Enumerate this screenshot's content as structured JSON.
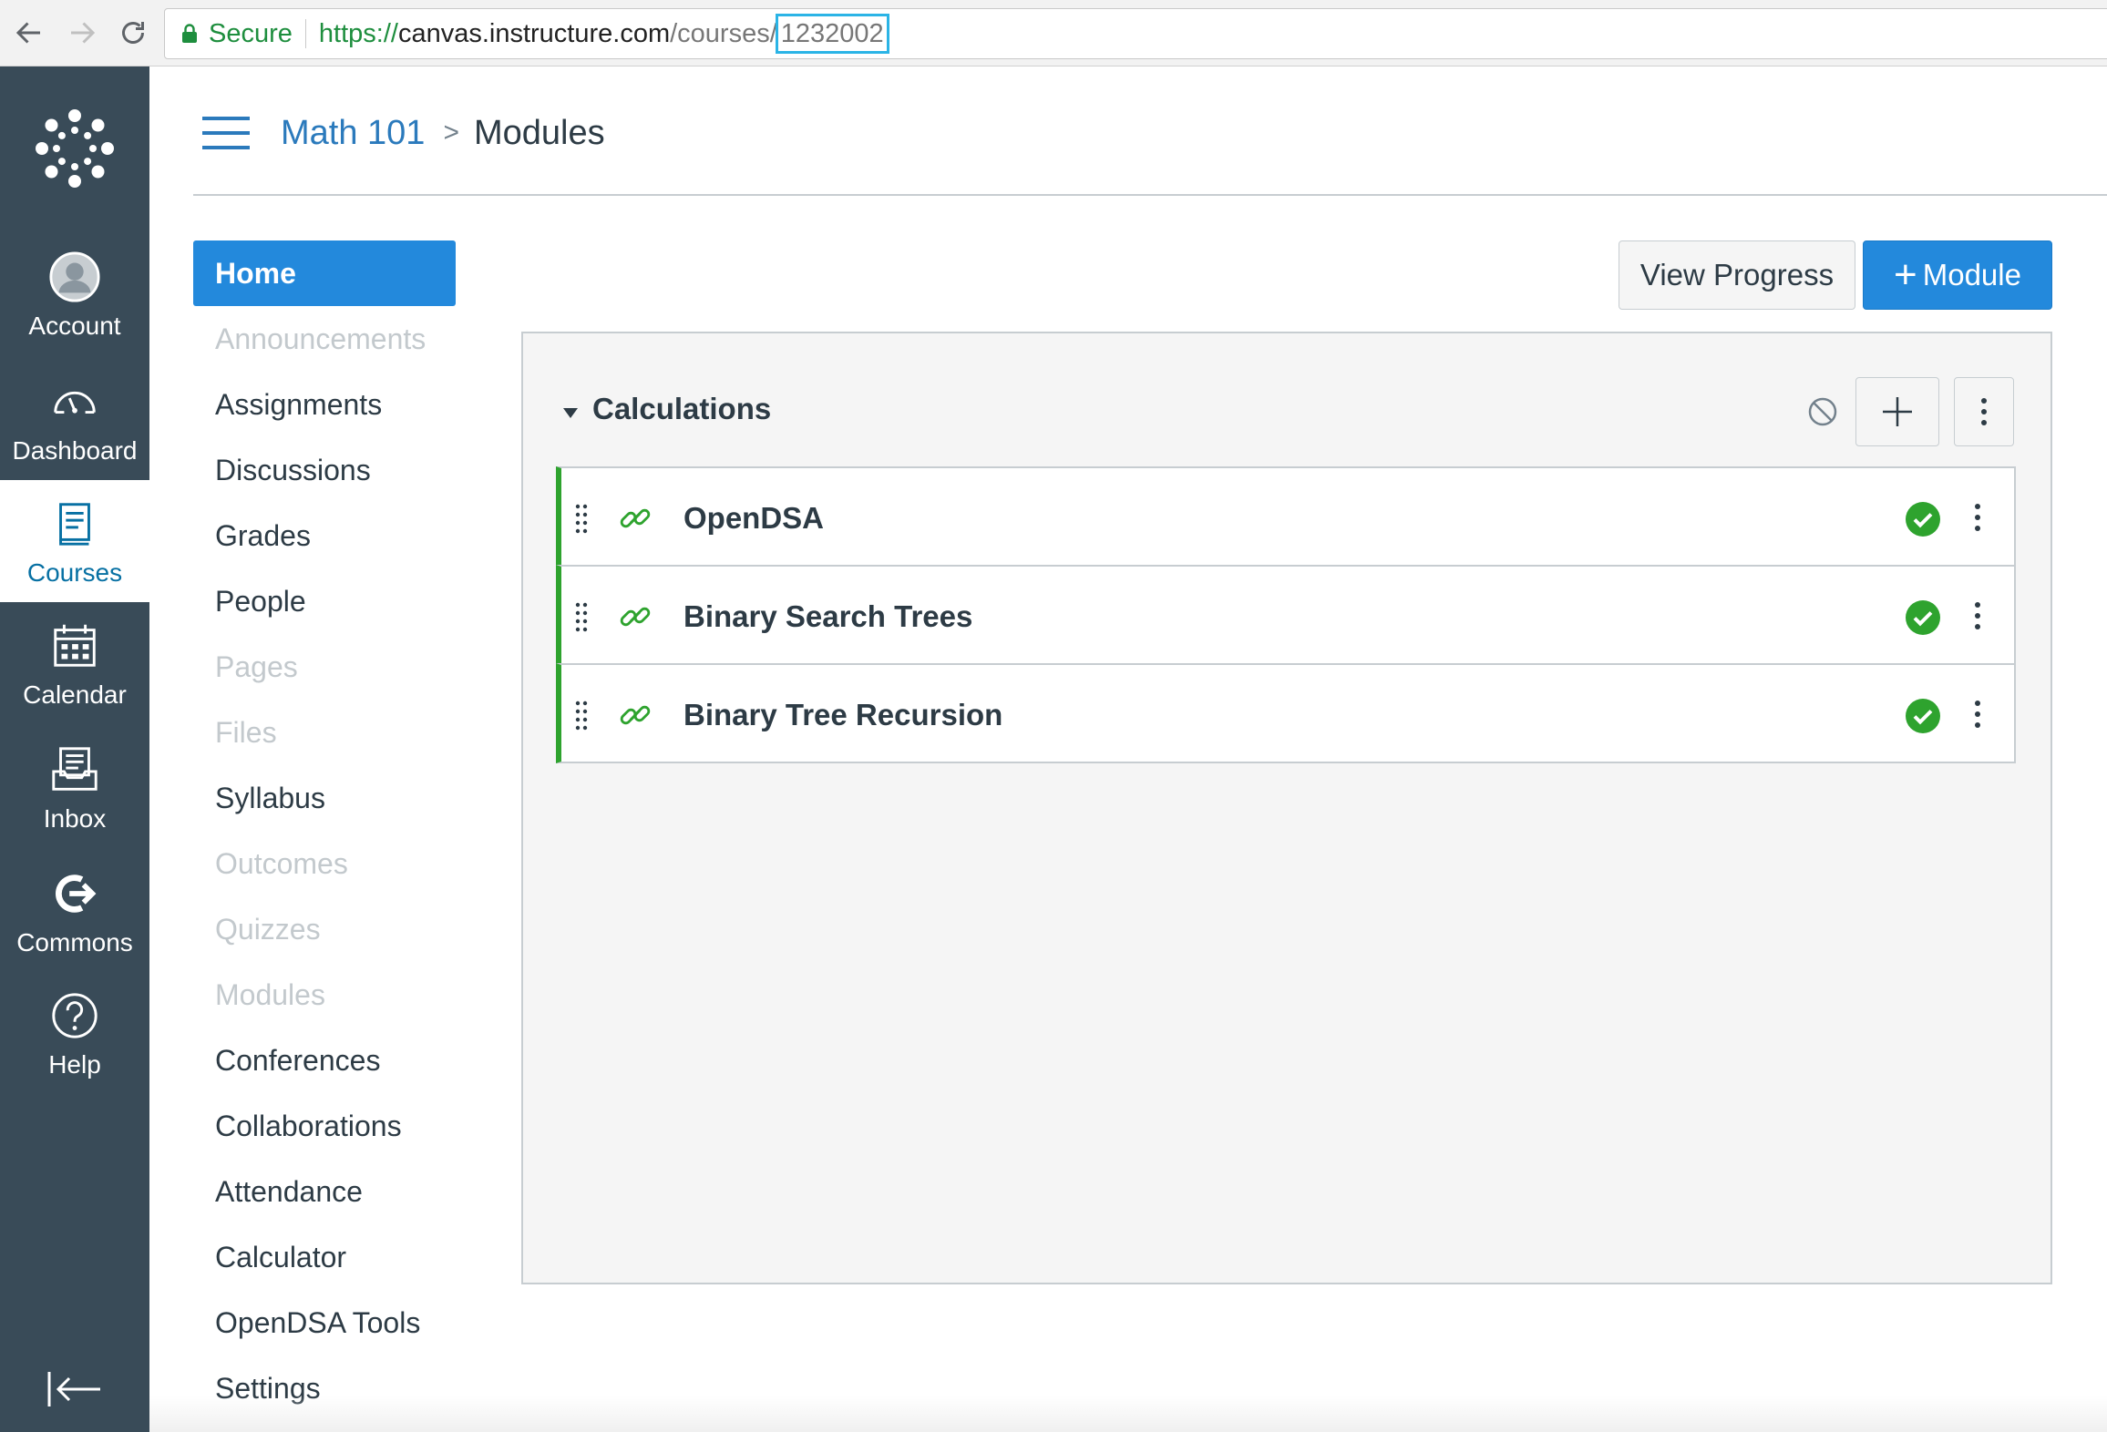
{
  "browser": {
    "secure_label": "Secure",
    "url_protocol": "https://",
    "url_host": "canvas.instructure.com",
    "url_path": "/courses/",
    "url_course_id": "1232002"
  },
  "global_nav": {
    "items": [
      {
        "label": "Account",
        "icon": "account-icon"
      },
      {
        "label": "Dashboard",
        "icon": "dashboard-icon"
      },
      {
        "label": "Courses",
        "icon": "courses-icon",
        "active": true
      },
      {
        "label": "Calendar",
        "icon": "calendar-icon"
      },
      {
        "label": "Inbox",
        "icon": "inbox-icon"
      },
      {
        "label": "Commons",
        "icon": "commons-icon"
      },
      {
        "label": "Help",
        "icon": "help-icon"
      }
    ],
    "colors": {
      "background": "#394b58",
      "active_text": "#0770a3"
    }
  },
  "header": {
    "breadcrumb_course": "Math 101",
    "breadcrumb_separator": ">",
    "breadcrumb_current": "Modules"
  },
  "course_nav": {
    "items": [
      {
        "label": "Home",
        "state": "active"
      },
      {
        "label": "Announcements",
        "state": "disabled"
      },
      {
        "label": "Assignments",
        "state": "enabled"
      },
      {
        "label": "Discussions",
        "state": "enabled"
      },
      {
        "label": "Grades",
        "state": "enabled"
      },
      {
        "label": "People",
        "state": "enabled"
      },
      {
        "label": "Pages",
        "state": "disabled"
      },
      {
        "label": "Files",
        "state": "disabled"
      },
      {
        "label": "Syllabus",
        "state": "enabled"
      },
      {
        "label": "Outcomes",
        "state": "disabled"
      },
      {
        "label": "Quizzes",
        "state": "disabled"
      },
      {
        "label": "Modules",
        "state": "disabled"
      },
      {
        "label": "Conferences",
        "state": "enabled"
      },
      {
        "label": "Collaborations",
        "state": "enabled"
      },
      {
        "label": "Attendance",
        "state": "enabled"
      },
      {
        "label": "Calculator",
        "state": "enabled"
      },
      {
        "label": "OpenDSA Tools",
        "state": "enabled"
      },
      {
        "label": "Settings",
        "state": "enabled"
      }
    ],
    "colors": {
      "active_bg": "#2389dc",
      "disabled_text": "#c3c9cd"
    }
  },
  "toolbar": {
    "view_progress_label": "View Progress",
    "add_module_plus": "+",
    "add_module_label": "Module"
  },
  "module": {
    "title": "Calculations",
    "items": [
      {
        "title": "OpenDSA",
        "type": "link-icon",
        "published": true
      },
      {
        "title": "Binary Search Trees",
        "type": "link-icon",
        "published": true
      },
      {
        "title": "Binary Tree Recursion",
        "type": "link-icon",
        "published": true
      }
    ],
    "colors": {
      "published": "#2ea32e",
      "accent": "#2389dc"
    }
  }
}
